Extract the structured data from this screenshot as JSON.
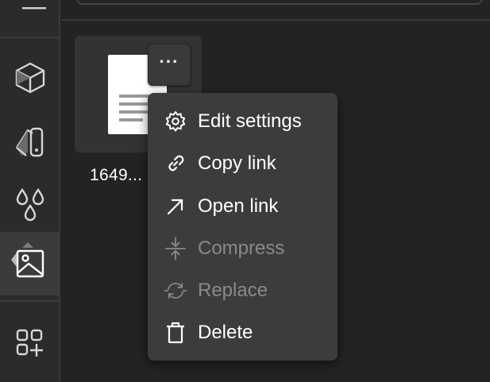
{
  "rail": {
    "items": [
      {
        "name": "3d-models",
        "icon": "cube-icon"
      },
      {
        "name": "materials",
        "icon": "paint-swatch-icon"
      },
      {
        "name": "drops",
        "icon": "droplets-icon"
      },
      {
        "name": "images",
        "icon": "image-icon",
        "active": true
      },
      {
        "name": "add-widget",
        "icon": "add-grid-icon"
      }
    ]
  },
  "file": {
    "label": "1649..."
  },
  "more_button": {
    "label": "···",
    "icon": "ellipsis-icon"
  },
  "context_menu": {
    "items": [
      {
        "label": "Edit settings",
        "icon": "gear-icon",
        "enabled": true
      },
      {
        "label": "Copy link",
        "icon": "link-icon",
        "enabled": true
      },
      {
        "label": "Open link",
        "icon": "arrow-up-right-icon",
        "enabled": true
      },
      {
        "label": "Compress",
        "icon": "compress-icon",
        "enabled": false
      },
      {
        "label": "Replace",
        "icon": "refresh-icon",
        "enabled": false
      },
      {
        "label": "Delete",
        "icon": "trash-icon",
        "enabled": true
      }
    ]
  },
  "colors": {
    "background": "#232323",
    "rail": "#2b2b2b",
    "menu": "#3c3c3c",
    "disabled_text": "#8a8a8a"
  }
}
